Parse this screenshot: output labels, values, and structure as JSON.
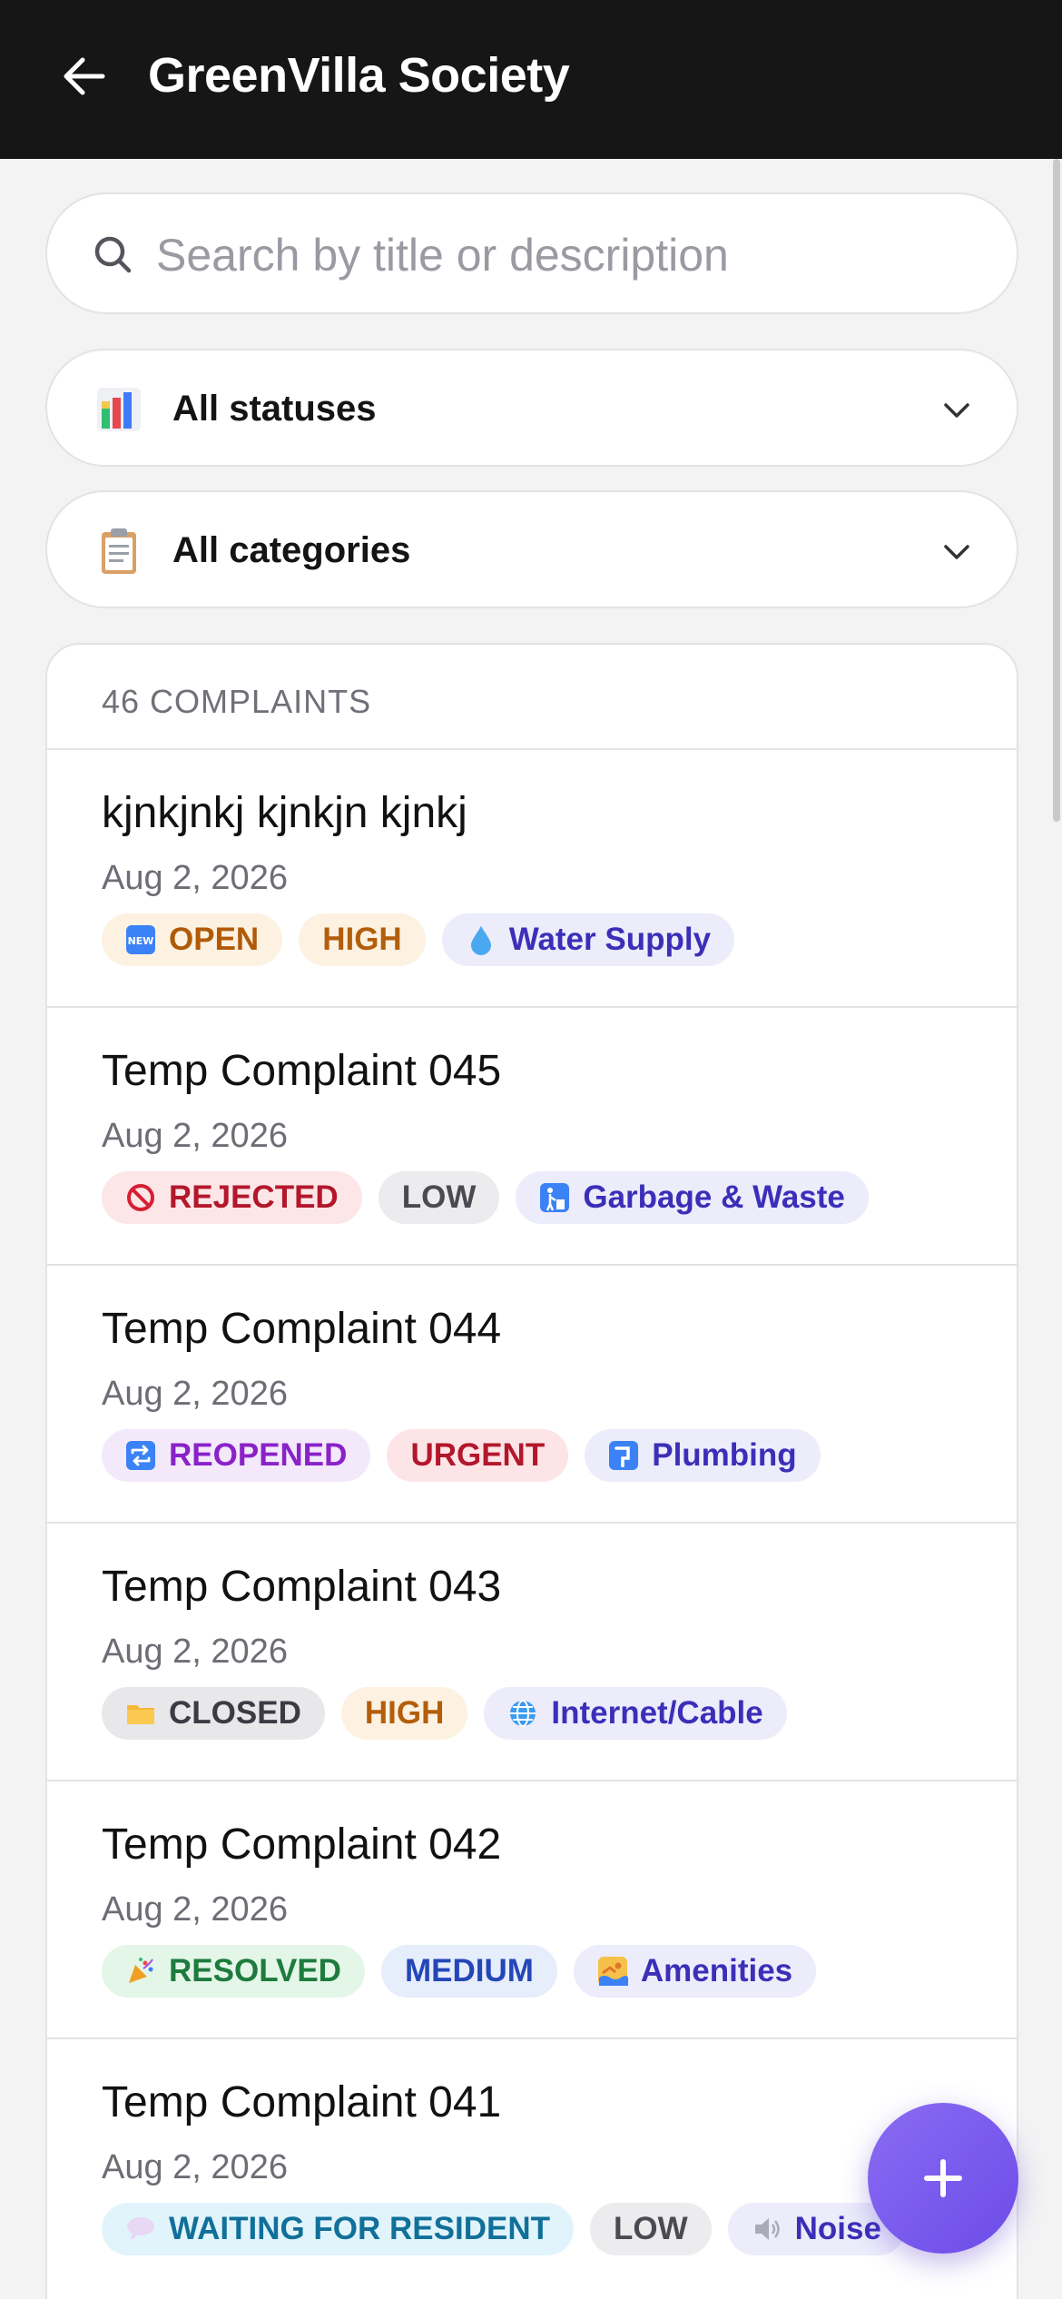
{
  "header": {
    "title": "GreenVilla Society"
  },
  "search": {
    "placeholder": "Search by title or description",
    "value": ""
  },
  "filters": {
    "status": {
      "label": "All statuses",
      "icon": "bar-chart-icon"
    },
    "category": {
      "label": "All categories",
      "icon": "clipboard-icon"
    }
  },
  "list": {
    "count_label": "46 COMPLAINTS",
    "items": [
      {
        "title": "kjnkjnkj kjnkjn kjnkj",
        "date": "Aug 2, 2026",
        "status": "OPEN",
        "priority": "HIGH",
        "category": "Water Supply"
      },
      {
        "title": "Temp Complaint 045",
        "date": "Aug 2, 2026",
        "status": "REJECTED",
        "priority": "LOW",
        "category": "Garbage & Waste"
      },
      {
        "title": "Temp Complaint 044",
        "date": "Aug 2, 2026",
        "status": "REOPENED",
        "priority": "URGENT",
        "category": "Plumbing"
      },
      {
        "title": "Temp Complaint 043",
        "date": "Aug 2, 2026",
        "status": "CLOSED",
        "priority": "HIGH",
        "category": "Internet/Cable"
      },
      {
        "title": "Temp Complaint 042",
        "date": "Aug 2, 2026",
        "status": "RESOLVED",
        "priority": "MEDIUM",
        "category": "Amenities"
      },
      {
        "title": "Temp Complaint 041",
        "date": "Aug 2, 2026",
        "status": "WAITING FOR RESIDENT",
        "priority": "LOW",
        "category": "Noise"
      }
    ]
  },
  "colors": {
    "header_bg": "#161616",
    "fab_accent": "#7a5af0",
    "category_text": "#3b2fb8"
  }
}
